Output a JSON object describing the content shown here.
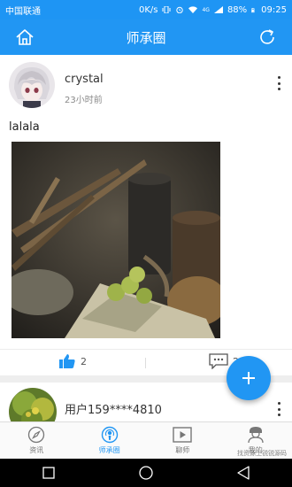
{
  "status_bar": {
    "carrier": "中国联通",
    "net_speed": "0K/s",
    "signal_badge": "4G",
    "battery": "88%",
    "time": "09:25"
  },
  "app_bar": {
    "title": "师承圈",
    "left_icon": "home-icon",
    "right_icon": "refresh-icon"
  },
  "posts": [
    {
      "author": "crystal",
      "time": "23小时前",
      "text": "lalala",
      "likes": "2",
      "comments": "2"
    },
    {
      "author": "用户159****4810"
    }
  ],
  "tabs": [
    {
      "label": "资讯",
      "icon": "compass-icon"
    },
    {
      "label": "师承圈",
      "icon": "podcast-icon"
    },
    {
      "label": "聊师",
      "icon": "video-play-icon"
    },
    {
      "label": "我的",
      "icon": "profile-icon"
    }
  ],
  "watermark": "找资源上锐锐源码",
  "colors": {
    "primary": "#2196f3",
    "status_bar": "#1e95f4"
  }
}
